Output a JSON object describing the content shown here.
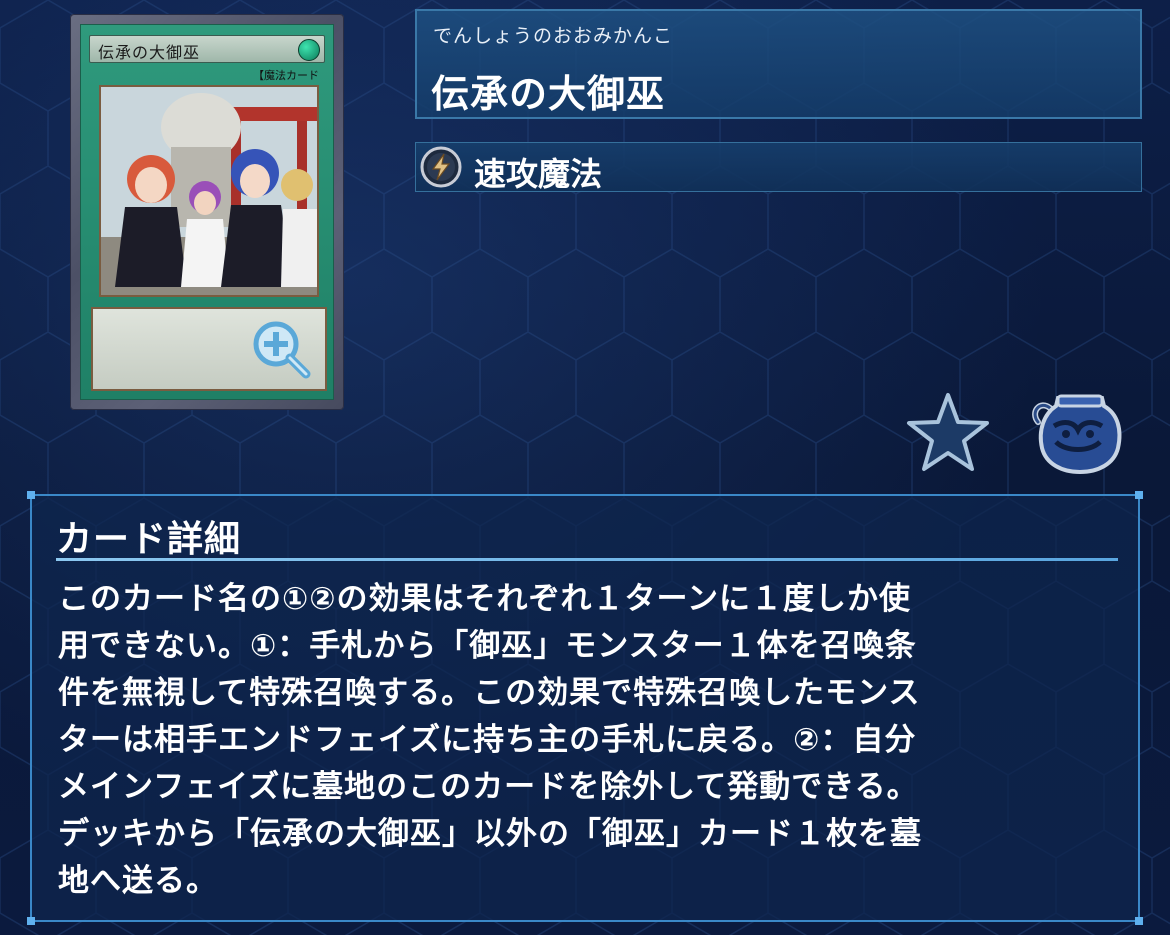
{
  "card_image": {
    "name_text": "伝承の大御巫",
    "type_text": "【魔法カード",
    "zoom_icon": "zoom-in-magnifier-icon"
  },
  "card": {
    "reading": "でんしょうのおおみかんこ",
    "name": "伝承の大御巫",
    "type_icon": "quick-play-spell-icon",
    "type_label": "速攻魔法"
  },
  "actions": {
    "favorite_icon": "star-icon",
    "pot_icon": "pot-of-greed-icon"
  },
  "details": {
    "title": "カード詳細",
    "lines": [
      "このカード名の①②の効果はそれぞれ１ターンに１度しか使",
      "用できない。①：手札から「御巫」モンスター１体を召喚条",
      "件を無視して特殊召喚する。この効果で特殊召喚したモンス",
      "ターは相手エンドフェイズに持ち主の手札に戻る。②：自分",
      "メインフェイズに墓地のこのカードを除外して発動できる。",
      "デッキから「伝承の大御巫」以外の「御巫」カード１枚を墓",
      "地へ送る。"
    ]
  },
  "colors": {
    "background": "#0b1a3d",
    "panel_border": "#3a88c8",
    "spell_green": "#2f9a7d"
  }
}
